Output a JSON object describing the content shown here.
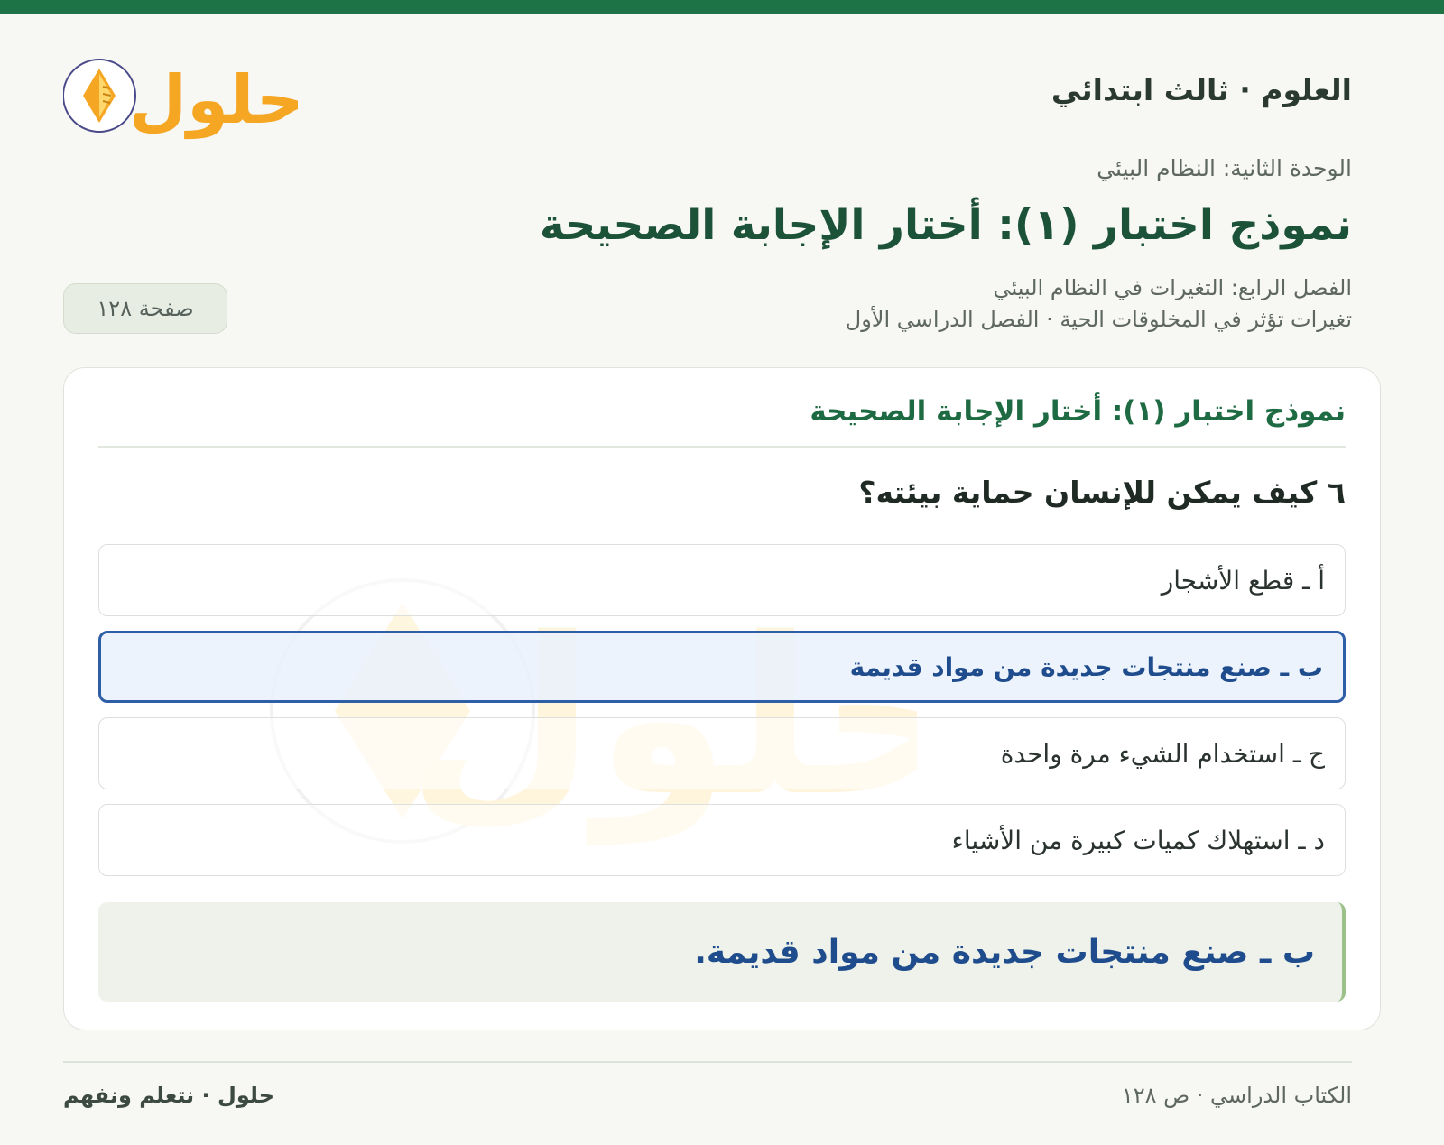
{
  "header": {
    "subject_title": "العلوم · ثالث ابتدائي",
    "logo_text": "حلول"
  },
  "meta": {
    "unit": "الوحدة الثانية: النظام البيئي",
    "page_title": "نموذج اختبار (١): أختار الإجابة الصحيحة",
    "chapter": "الفصل الرابع: التغيرات في النظام البيئي",
    "lesson": "تغيرات تؤثر في المخلوقات الحية · الفصل الدراسي الأول",
    "page_badge": "صفحة ١٢٨"
  },
  "card": {
    "heading": "نموذج اختبار (١): أختار الإجابة الصحيحة",
    "question": "٦ كيف يمكن للإنسان حماية بيئته؟",
    "options": [
      {
        "label": "أ ـ قطع الأشجار",
        "selected": false
      },
      {
        "label": "ب ـ صنع منتجات جديدة من مواد قديمة",
        "selected": true
      },
      {
        "label": "ج ـ استخدام الشيء مرة واحدة",
        "selected": false
      },
      {
        "label": "د ـ استهلاك كميات كبيرة من الأشياء",
        "selected": false
      }
    ],
    "answer": "ب ـ صنع منتجات جديدة من مواد قديمة."
  },
  "footer": {
    "right": "الكتاب الدراسي · ص ١٢٨",
    "left": "حلول · نتعلم ونفهم"
  },
  "colors": {
    "brand_green": "#1e7346",
    "selected_blue": "#2d5ea6",
    "logo_orange": "#f5a623"
  }
}
